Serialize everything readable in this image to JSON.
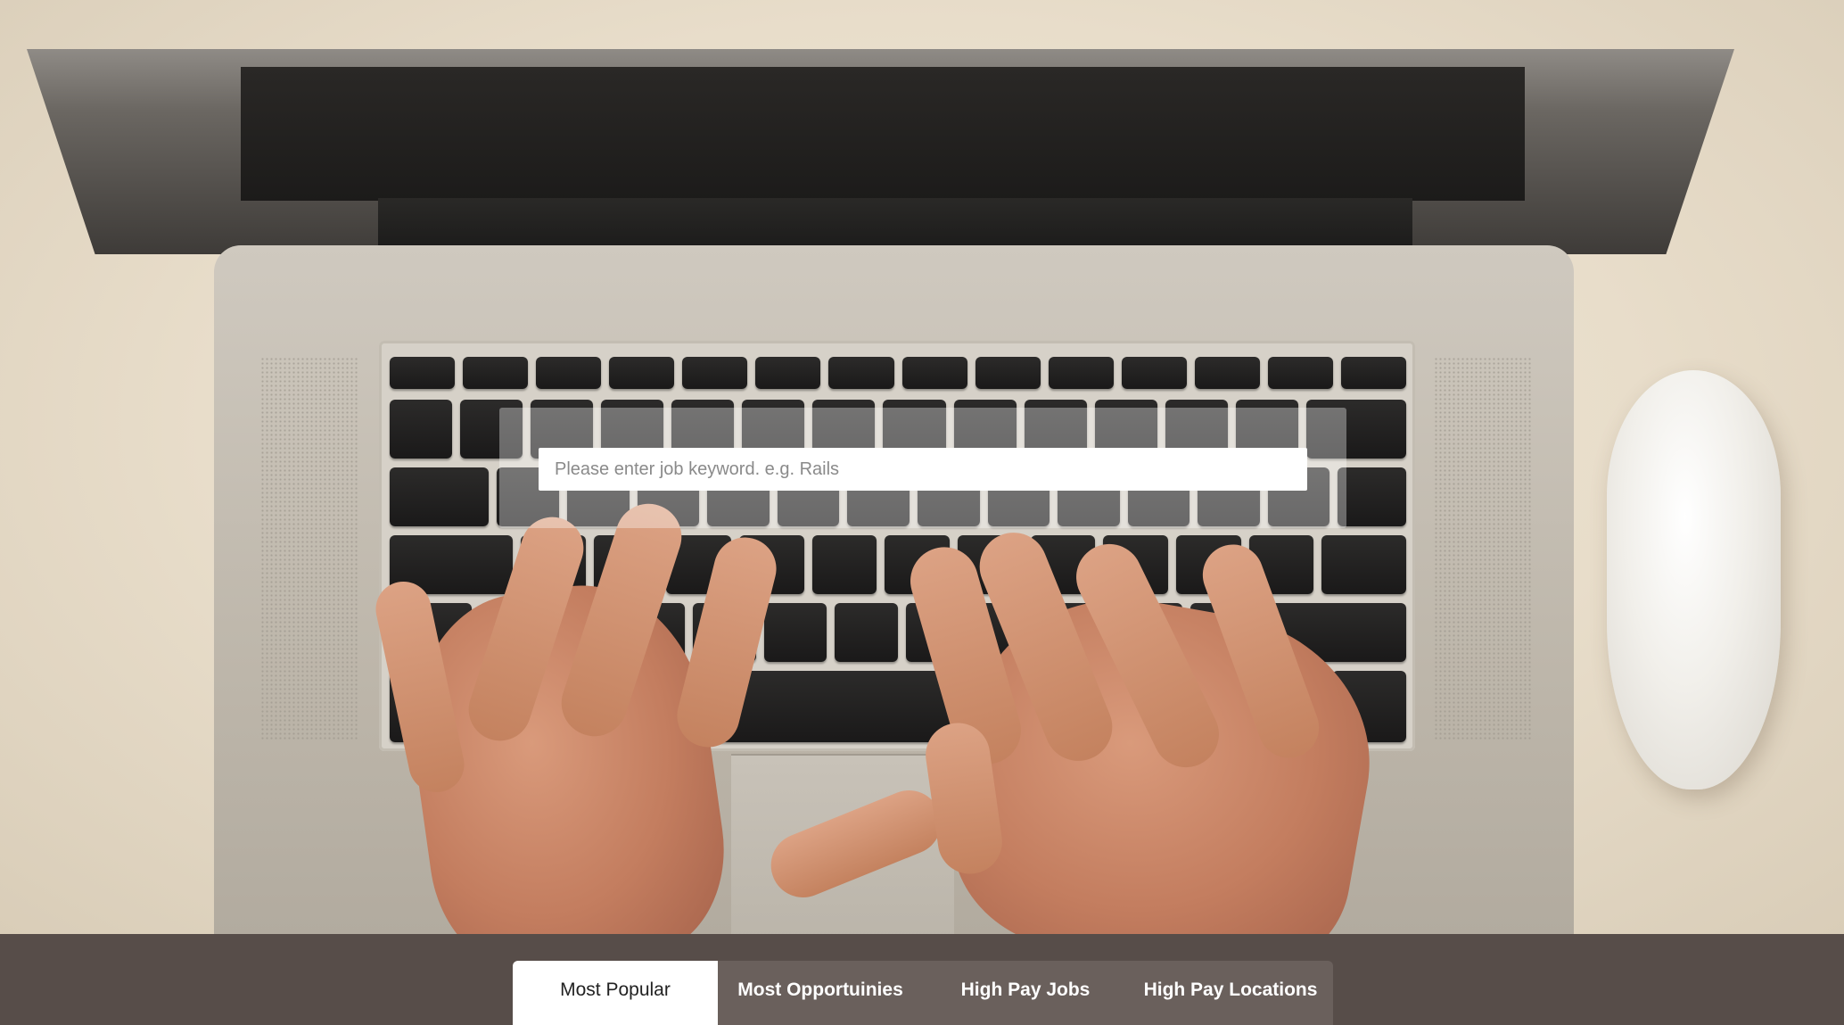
{
  "hero": {
    "background_image": "laptop-typing-photo"
  },
  "search": {
    "placeholder": "Please enter job keyword. e.g. Rails",
    "value": ""
  },
  "tabs": [
    {
      "label": "Most Popular",
      "active": true
    },
    {
      "label": "Most Opportuinies",
      "active": false
    },
    {
      "label": "High Pay Jobs",
      "active": false
    },
    {
      "label": "High Pay Locations",
      "active": false
    }
  ],
  "colors": {
    "bottom_bar": "#574d49",
    "tab_bar": "#6a605c",
    "active_tab_bg": "#ffffff",
    "active_tab_text": "#222222",
    "inactive_tab_text": "#ffffff"
  }
}
